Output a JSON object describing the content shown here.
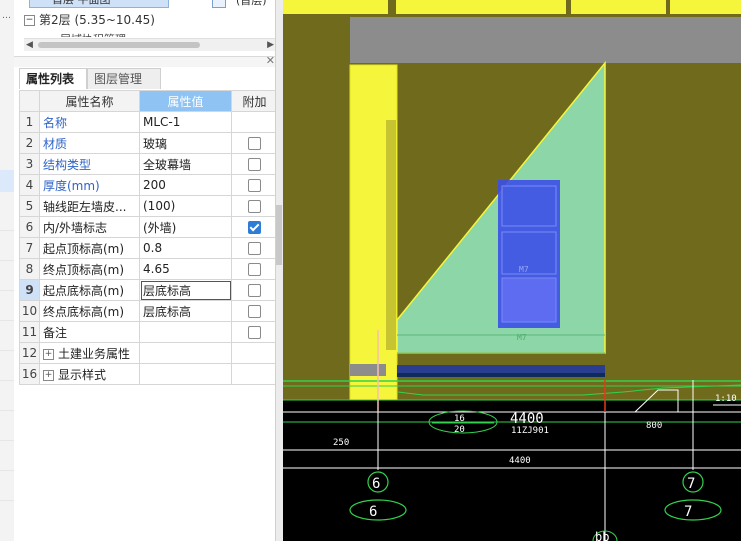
{
  "tree": {
    "header_btn": "首层 平面图",
    "header_side": "(首层)",
    "layer_node": "第2层 (5.35~10.45)",
    "child_partial": "层域协程管理"
  },
  "tabs": {
    "properties": "属性列表",
    "layers": "图层管理"
  },
  "columns": {
    "name": "属性名称",
    "value": "属性值",
    "extra": "附加"
  },
  "rows": [
    {
      "num": "1",
      "name": "名称",
      "value": "MLC-1",
      "blue": true,
      "checkbox": null
    },
    {
      "num": "2",
      "name": "材质",
      "value": "玻璃",
      "blue": true,
      "checkbox": false
    },
    {
      "num": "3",
      "name": "结构类型",
      "value": "全玻幕墙",
      "blue": true,
      "checkbox": false
    },
    {
      "num": "4",
      "name": "厚度(mm)",
      "value": "200",
      "blue": true,
      "checkbox": false
    },
    {
      "num": "5",
      "name": "轴线距左墙皮...",
      "value": "(100)",
      "blue": false,
      "checkbox": false
    },
    {
      "num": "6",
      "name": "内/外墙标志",
      "value": "(外墙)",
      "blue": false,
      "checkbox": true
    },
    {
      "num": "7",
      "name": "起点顶标高(m)",
      "value": "0.8",
      "blue": false,
      "checkbox": false
    },
    {
      "num": "8",
      "name": "终点顶标高(m)",
      "value": "4.65",
      "blue": false,
      "checkbox": false
    },
    {
      "num": "9",
      "name": "起点底标高(m)",
      "value": "层底标高",
      "blue": false,
      "checkbox": false
    },
    {
      "num": "10",
      "name": "终点底标高(m)",
      "value": "层底标高",
      "blue": false,
      "checkbox": false
    },
    {
      "num": "11",
      "name": "备注",
      "value": "",
      "blue": false,
      "checkbox": false
    }
  ],
  "groups": [
    {
      "num": "12",
      "name": "土建业务属性"
    },
    {
      "num": "16",
      "name": "显示样式"
    }
  ],
  "cad": {
    "dim_4400_a": "4400",
    "dim_4400_b": "4400",
    "dim_250": "250",
    "dim_800": "800",
    "ref_16": "16",
    "ref_20": "20",
    "ref_code": "11ZJ901",
    "scale": "1:10",
    "axis_6": "6",
    "axis_7": "7",
    "axis_bubble_6": "6",
    "axis_bubble_7": "7",
    "win_m7_a": "M7",
    "win_m7_b": "M7",
    "edge_label": "bb"
  },
  "colors": {
    "olive": "#706b1c",
    "yellow": "#f5f53b",
    "gray": "#8c8c8c",
    "glass": "#8cd6a8",
    "blue_window": "#3b4fe8",
    "cad_green": "#33d14d"
  }
}
